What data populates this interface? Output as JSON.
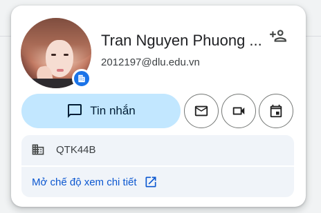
{
  "profile": {
    "name": "Tran Nguyen Phuong ...",
    "email": "2012197@dlu.edu.vn"
  },
  "actions": {
    "chat_label": "Tin nhắn"
  },
  "info": {
    "location": "QTK44B",
    "details_link": "Mở chế độ xem chi tiết"
  },
  "colors": {
    "accent": "#1a73e8",
    "chat_button_bg": "#c2e7ff",
    "link": "#0b57d0"
  },
  "icons": [
    "add-contact-icon",
    "chat-icon",
    "mail-icon",
    "video-call-icon",
    "calendar-icon",
    "building-icon",
    "open-in-new-icon",
    "organization-badge-icon"
  ]
}
